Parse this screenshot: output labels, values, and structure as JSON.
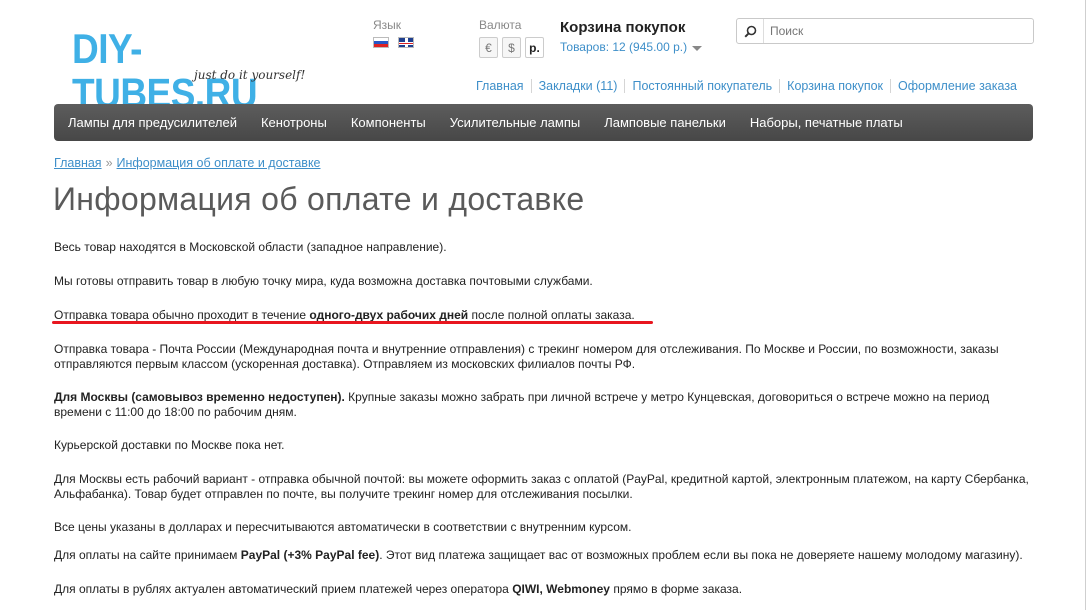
{
  "header": {
    "logo_title": "DIY-TUBES.RU",
    "logo_tagline": "just do it yourself!",
    "language_label": "Язык",
    "currency_label": "Валюта",
    "currencies": [
      "€",
      "$",
      "р."
    ],
    "active_currency": "р.",
    "cart_title": "Корзина покупок",
    "cart_summary": "Товаров: 12 (945.00 р.)",
    "search_placeholder": "Поиск"
  },
  "top_links": [
    "Главная",
    "Закладки (11)",
    "Постоянный покупатель",
    "Корзина покупок",
    "Оформление заказа"
  ],
  "nav": [
    "Лампы для предусилителей",
    "Кенотроны",
    "Компоненты",
    "Усилительные лампы",
    "Ламповые панельки",
    "Наборы, печатные платы"
  ],
  "breadcrumb": {
    "home": "Главная",
    "separator": "»",
    "current": "Информация об оплате и доставке"
  },
  "page_title": "Информация об оплате и доставке",
  "paragraphs": {
    "p1": "Весь товар находятся в Московской области (западное направление).",
    "p2": "Мы готовы отправить товар в любую точку мира, куда возможна доставка почтовыми службами.",
    "p3_before": "Отправка товара обычно проходит в течение ",
    "p3_bold": "одного-двух рабочих дней",
    "p3_after": " после полной оплаты заказа.",
    "p4": "Отправка товара - Почта России (Международная почта и внутренние отправления) с трекинг номером для отслеживания. По Москве и России, по возможности, заказы отправляются первым классом (ускоренная доставка). Отправляем из московских филиалов почты РФ.",
    "p5_bold": "Для Москвы (самовывоз временно недоступен).",
    "p5_text": " Крупные заказы можно забрать при личной встрече  у метро Кунцевская, договориться о встрече можно на период времени с 11:00 до 18:00 по рабочим дням.",
    "p6": "Курьерской доставки по Москве пока нет.",
    "p7": "Для Москвы есть рабочий вариант - отправка обычной почтой: вы можете оформить заказ с оплатой (PayPal, кредитной картой, электронным платежом, на карту Сбербанка, Альфабанка). Товар будет отправлен по почте, вы получите трекинг номер для отслеживания посылки.",
    "p8": "Все цены указаны в долларах и пересчитываются автоматически в соответствии с внутренним курсом.",
    "p9_before": "Для оплаты на сайте принимаем ",
    "p9_bold": "PayPal (+3% PayPal fee)",
    "p9_after": ". Этот вид платежа защищает вас от возможных проблем если вы пока не доверяете нашему молодому магазину).",
    "p10_before": "Для оплаты в рублях актуален автоматический прием платежей через оператора ",
    "p10_bold": "QIWI, Webmoney",
    "p10_after": " прямо в форме заказа."
  },
  "colors": {
    "link": "#3e8fc9",
    "logo": "#3fb0e6",
    "nav_bg": "#505050",
    "highlight": "#e8161f"
  }
}
